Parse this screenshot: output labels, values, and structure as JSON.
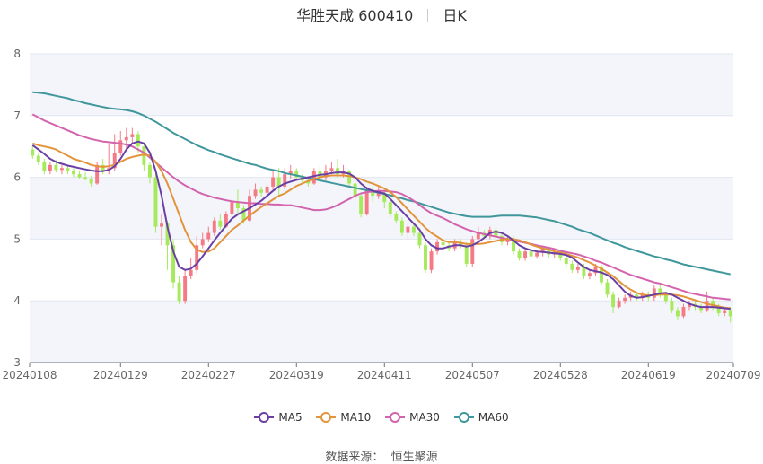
{
  "title": {
    "name": "华胜天成 600410",
    "period": "日K"
  },
  "source": {
    "label": "数据来源：",
    "value": "恒生聚源"
  },
  "colors": {
    "up": "#f47a86",
    "down": "#a6ea5b",
    "ma5": "#6a3fa4",
    "ma10": "#e3943b",
    "ma30": "#d463ad",
    "ma60": "#3f979b",
    "band": "#f3f5fb",
    "grid": "#e0e6f1"
  },
  "chart_data": {
    "type": "candlestick",
    "title": "华胜天成 600410",
    "period": "日K",
    "ylim": [
      3,
      8
    ],
    "yticks": [
      3,
      4,
      5,
      6,
      7,
      8
    ],
    "xtick_labels": [
      "20240108",
      "20240129",
      "20240227",
      "20240319",
      "20240411",
      "20240507",
      "20240528",
      "20240619",
      "20240709"
    ],
    "legend": [
      "MA5",
      "MA10",
      "MA30",
      "MA60"
    ],
    "dates": [
      "20240108",
      "20240109",
      "20240110",
      "20240111",
      "20240112",
      "20240115",
      "20240116",
      "20240117",
      "20240118",
      "20240119",
      "20240122",
      "20240123",
      "20240124",
      "20240125",
      "20240126",
      "20240129",
      "20240130",
      "20240131",
      "20240201",
      "20240202",
      "20240205",
      "20240206",
      "20240207",
      "20240208",
      "20240219",
      "20240220",
      "20240221",
      "20240222",
      "20240223",
      "20240226",
      "20240227",
      "20240228",
      "20240229",
      "20240301",
      "20240304",
      "20240305",
      "20240306",
      "20240307",
      "20240308",
      "20240311",
      "20240312",
      "20240313",
      "20240314",
      "20240315",
      "20240318",
      "20240319",
      "20240320",
      "20240321",
      "20240322",
      "20240325",
      "20240326",
      "20240327",
      "20240328",
      "20240329",
      "20240401",
      "20240402",
      "20240403",
      "20240408",
      "20240409",
      "20240410",
      "20240411",
      "20240412",
      "20240415",
      "20240416",
      "20240417",
      "20240418",
      "20240419",
      "20240422",
      "20240423",
      "20240424",
      "20240425",
      "20240426",
      "20240429",
      "20240430",
      "20240506",
      "20240507",
      "20240508",
      "20240509",
      "20240510",
      "20240513",
      "20240514",
      "20240515",
      "20240516",
      "20240517",
      "20240520",
      "20240521",
      "20240522",
      "20240523",
      "20240524",
      "20240527",
      "20240528",
      "20240529",
      "20240530",
      "20240531",
      "20240603",
      "20240604",
      "20240605",
      "20240606",
      "20240607",
      "20240611",
      "20240612",
      "20240613",
      "20240614",
      "20240617",
      "20240618",
      "20240619",
      "20240620",
      "20240621",
      "20240624",
      "20240625",
      "20240626",
      "20240627",
      "20240628",
      "20240701",
      "20240702",
      "20240703",
      "20240704",
      "20240705",
      "20240708",
      "20240709"
    ],
    "ohlc": [
      [
        6.45,
        6.35,
        6.3,
        6.5
      ],
      [
        6.35,
        6.25,
        6.2,
        6.4
      ],
      [
        6.25,
        6.1,
        6.05,
        6.3
      ],
      [
        6.1,
        6.2,
        6.05,
        6.25
      ],
      [
        6.2,
        6.12,
        6.08,
        6.28
      ],
      [
        6.12,
        6.15,
        6.05,
        6.2
      ],
      [
        6.15,
        6.1,
        6.05,
        6.2
      ],
      [
        6.1,
        6.05,
        6.0,
        6.15
      ],
      [
        6.05,
        6.0,
        5.98,
        6.1
      ],
      [
        6.0,
        5.98,
        5.95,
        6.08
      ],
      [
        5.98,
        5.9,
        5.85,
        6.02
      ],
      [
        5.9,
        6.2,
        5.88,
        6.25
      ],
      [
        6.2,
        6.1,
        6.05,
        6.3
      ],
      [
        6.1,
        6.15,
        6.05,
        6.55
      ],
      [
        6.15,
        6.4,
        6.1,
        6.7
      ],
      [
        6.4,
        6.6,
        6.35,
        6.75
      ],
      [
        6.6,
        6.65,
        6.45,
        6.8
      ],
      [
        6.65,
        6.7,
        6.55,
        6.8
      ],
      [
        6.7,
        6.5,
        6.4,
        6.75
      ],
      [
        6.5,
        6.2,
        6.1,
        6.55
      ],
      [
        6.2,
        6.0,
        5.9,
        6.25
      ],
      [
        6.0,
        5.2,
        5.1,
        6.05
      ],
      [
        5.2,
        5.25,
        4.9,
        5.4
      ],
      [
        5.25,
        4.9,
        4.5,
        5.3
      ],
      [
        4.9,
        4.3,
        4.2,
        5.0
      ],
      [
        4.3,
        4.0,
        3.95,
        4.4
      ],
      [
        4.0,
        4.4,
        3.95,
        4.5
      ],
      [
        4.4,
        4.5,
        4.35,
        4.7
      ],
      [
        4.5,
        4.9,
        4.45,
        5.05
      ],
      [
        4.9,
        5.0,
        4.85,
        5.1
      ],
      [
        5.0,
        5.1,
        4.95,
        5.2
      ],
      [
        5.1,
        5.3,
        5.05,
        5.35
      ],
      [
        5.3,
        5.2,
        5.15,
        5.4
      ],
      [
        5.2,
        5.4,
        5.18,
        5.45
      ],
      [
        5.4,
        5.6,
        5.35,
        5.65
      ],
      [
        5.6,
        5.5,
        5.4,
        5.8
      ],
      [
        5.5,
        5.3,
        5.25,
        5.55
      ],
      [
        5.3,
        5.7,
        5.28,
        5.8
      ],
      [
        5.7,
        5.8,
        5.65,
        5.9
      ],
      [
        5.8,
        5.75,
        5.68,
        5.85
      ],
      [
        5.75,
        5.85,
        5.7,
        5.9
      ],
      [
        5.85,
        6.0,
        5.8,
        6.1
      ],
      [
        6.0,
        5.85,
        5.7,
        6.15
      ],
      [
        5.85,
        6.05,
        5.8,
        6.15
      ],
      [
        6.05,
        6.1,
        5.98,
        6.2
      ],
      [
        6.1,
        6.0,
        5.95,
        6.15
      ],
      [
        6.0,
        5.95,
        5.9,
        6.05
      ],
      [
        5.95,
        5.9,
        5.85,
        6.0
      ],
      [
        5.9,
        6.1,
        5.88,
        6.15
      ],
      [
        6.1,
        6.0,
        5.95,
        6.2
      ],
      [
        6.0,
        6.1,
        5.95,
        6.2
      ],
      [
        6.1,
        6.15,
        6.05,
        6.25
      ],
      [
        6.15,
        6.05,
        6.0,
        6.3
      ],
      [
        6.05,
        6.1,
        6.0,
        6.2
      ],
      [
        6.1,
        5.9,
        5.85,
        6.12
      ],
      [
        5.9,
        5.7,
        5.6,
        5.95
      ],
      [
        5.7,
        5.4,
        5.35,
        5.75
      ],
      [
        5.4,
        5.8,
        5.38,
        5.85
      ],
      [
        5.8,
        5.7,
        5.6,
        5.85
      ],
      [
        5.7,
        5.75,
        5.65,
        5.85
      ],
      [
        5.75,
        5.6,
        5.5,
        5.8
      ],
      [
        5.6,
        5.4,
        5.35,
        5.65
      ],
      [
        5.4,
        5.3,
        5.25,
        5.45
      ],
      [
        5.3,
        5.1,
        5.05,
        5.35
      ],
      [
        5.1,
        5.2,
        5.0,
        5.25
      ],
      [
        5.2,
        5.1,
        5.05,
        5.25
      ],
      [
        5.1,
        4.9,
        4.85,
        5.15
      ],
      [
        4.9,
        4.5,
        4.45,
        4.95
      ],
      [
        4.5,
        4.8,
        4.45,
        4.85
      ],
      [
        4.8,
        4.95,
        4.75,
        5.0
      ],
      [
        4.95,
        4.9,
        4.8,
        5.0
      ],
      [
        4.9,
        4.85,
        4.8,
        4.95
      ],
      [
        4.85,
        4.95,
        4.8,
        5.0
      ],
      [
        4.95,
        4.9,
        4.85,
        5.0
      ],
      [
        4.9,
        4.6,
        4.55,
        4.95
      ],
      [
        4.6,
        5.0,
        4.55,
        5.05
      ],
      [
        5.0,
        5.1,
        4.95,
        5.2
      ],
      [
        5.1,
        5.05,
        5.0,
        5.15
      ],
      [
        5.05,
        5.15,
        5.0,
        5.2
      ],
      [
        5.15,
        5.05,
        4.95,
        5.2
      ],
      [
        5.05,
        4.95,
        4.9,
        5.1
      ],
      [
        4.95,
        5.0,
        4.9,
        5.05
      ],
      [
        5.0,
        4.8,
        4.75,
        5.05
      ],
      [
        4.8,
        4.7,
        4.65,
        4.85
      ],
      [
        4.7,
        4.8,
        4.65,
        4.85
      ],
      [
        4.8,
        4.72,
        4.68,
        4.85
      ],
      [
        4.72,
        4.78,
        4.68,
        4.82
      ],
      [
        4.78,
        4.85,
        4.72,
        4.9
      ],
      [
        4.85,
        4.75,
        4.7,
        4.88
      ],
      [
        4.75,
        4.78,
        4.7,
        4.82
      ],
      [
        4.78,
        4.7,
        4.65,
        4.82
      ],
      [
        4.7,
        4.6,
        4.55,
        4.75
      ],
      [
        4.6,
        4.5,
        4.45,
        4.65
      ],
      [
        4.5,
        4.55,
        4.45,
        4.6
      ],
      [
        4.55,
        4.4,
        4.35,
        4.6
      ],
      [
        4.4,
        4.45,
        4.35,
        4.5
      ],
      [
        4.45,
        4.55,
        4.4,
        4.6
      ],
      [
        4.55,
        4.3,
        4.25,
        4.58
      ],
      [
        4.3,
        4.1,
        4.05,
        4.35
      ],
      [
        4.1,
        3.9,
        3.8,
        4.15
      ],
      [
        3.9,
        4.0,
        3.88,
        4.05
      ],
      [
        4.0,
        4.05,
        3.95,
        4.1
      ],
      [
        4.05,
        4.1,
        4.0,
        4.15
      ],
      [
        4.1,
        4.05,
        4.0,
        4.15
      ],
      [
        4.05,
        4.1,
        4.0,
        4.15
      ],
      [
        4.1,
        4.05,
        4.0,
        4.15
      ],
      [
        4.05,
        4.2,
        4.0,
        4.25
      ],
      [
        4.2,
        4.1,
        4.05,
        4.25
      ],
      [
        4.1,
        4.0,
        3.95,
        4.15
      ],
      [
        4.0,
        3.85,
        3.8,
        4.05
      ],
      [
        3.85,
        3.75,
        3.7,
        3.9
      ],
      [
        3.75,
        3.9,
        3.72,
        3.95
      ],
      [
        3.9,
        3.95,
        3.85,
        4.0
      ],
      [
        3.95,
        3.9,
        3.85,
        4.0
      ],
      [
        3.9,
        3.85,
        3.8,
        3.95
      ],
      [
        3.85,
        4.0,
        3.82,
        4.15
      ],
      [
        4.0,
        3.9,
        3.85,
        4.05
      ],
      [
        3.9,
        3.8,
        3.75,
        3.95
      ],
      [
        3.8,
        3.85,
        3.75,
        3.9
      ],
      [
        3.85,
        3.75,
        3.65,
        3.9
      ]
    ],
    "ma5": [
      6.52,
      6.45,
      6.38,
      6.3,
      6.25,
      6.22,
      6.19,
      6.17,
      6.15,
      6.13,
      6.11,
      6.1,
      6.1,
      6.12,
      6.18,
      6.3,
      6.45,
      6.55,
      6.58,
      6.55,
      6.4,
      6.1,
      5.7,
      5.2,
      4.8,
      4.55,
      4.5,
      4.52,
      4.6,
      4.72,
      4.85,
      4.98,
      5.1,
      5.22,
      5.33,
      5.4,
      5.45,
      5.5,
      5.56,
      5.62,
      5.7,
      5.78,
      5.85,
      5.9,
      5.93,
      5.96,
      5.98,
      6.0,
      6.02,
      6.04,
      6.05,
      6.07,
      6.08,
      6.08,
      6.06,
      6.0,
      5.9,
      5.82,
      5.78,
      5.76,
      5.74,
      5.65,
      5.55,
      5.45,
      5.35,
      5.25,
      5.15,
      5.0,
      4.9,
      4.85,
      4.85,
      4.88,
      4.9,
      4.9,
      4.88,
      4.9,
      4.95,
      5.02,
      5.1,
      5.12,
      5.1,
      5.05,
      4.98,
      4.9,
      4.85,
      4.82,
      4.8,
      4.79,
      4.78,
      4.77,
      4.76,
      4.74,
      4.7,
      4.62,
      4.55,
      4.5,
      4.48,
      4.46,
      4.42,
      4.35,
      4.25,
      4.15,
      4.08,
      4.05,
      4.06,
      4.08,
      4.1,
      4.12,
      4.13,
      4.1,
      4.05,
      4.0,
      3.95,
      3.92,
      3.9,
      3.9,
      3.9,
      3.89,
      3.88,
      3.87
    ],
    "ma10": [
      6.55,
      6.52,
      6.5,
      6.48,
      6.45,
      6.4,
      6.35,
      6.3,
      6.27,
      6.24,
      6.2,
      6.18,
      6.17,
      6.18,
      6.2,
      6.25,
      6.3,
      6.33,
      6.35,
      6.37,
      6.35,
      6.25,
      6.1,
      5.9,
      5.65,
      5.4,
      5.15,
      4.95,
      4.83,
      4.79,
      4.8,
      4.85,
      4.95,
      5.05,
      5.15,
      5.22,
      5.3,
      5.38,
      5.45,
      5.52,
      5.58,
      5.64,
      5.7,
      5.74,
      5.8,
      5.86,
      5.9,
      5.94,
      5.97,
      6.0,
      6.02,
      6.03,
      6.03,
      6.03,
      6.02,
      6.0,
      5.97,
      5.93,
      5.9,
      5.86,
      5.82,
      5.76,
      5.68,
      5.58,
      5.48,
      5.38,
      5.28,
      5.18,
      5.1,
      5.04,
      4.98,
      4.95,
      4.95,
      4.94,
      4.92,
      4.92,
      4.92,
      4.93,
      4.95,
      4.97,
      4.99,
      5.0,
      5.0,
      4.98,
      4.95,
      4.91,
      4.88,
      4.85,
      4.83,
      4.8,
      4.78,
      4.76,
      4.73,
      4.7,
      4.66,
      4.62,
      4.57,
      4.52,
      4.46,
      4.4,
      4.32,
      4.24,
      4.18,
      4.13,
      4.1,
      4.09,
      4.09,
      4.1,
      4.1,
      4.1,
      4.09,
      4.07,
      4.04,
      4.01,
      3.98,
      3.95,
      3.93,
      3.91,
      3.89,
      3.88
    ],
    "ma30": [
      7.02,
      6.97,
      6.92,
      6.88,
      6.84,
      6.8,
      6.76,
      6.72,
      6.68,
      6.65,
      6.62,
      6.6,
      6.58,
      6.57,
      6.56,
      6.55,
      6.53,
      6.5,
      6.45,
      6.4,
      6.32,
      6.24,
      6.16,
      6.08,
      6.0,
      5.93,
      5.87,
      5.82,
      5.77,
      5.73,
      5.7,
      5.67,
      5.65,
      5.63,
      5.61,
      5.6,
      5.59,
      5.58,
      5.58,
      5.57,
      5.57,
      5.56,
      5.56,
      5.55,
      5.55,
      5.53,
      5.51,
      5.49,
      5.47,
      5.47,
      5.48,
      5.51,
      5.55,
      5.6,
      5.65,
      5.7,
      5.74,
      5.76,
      5.77,
      5.78,
      5.78,
      5.77,
      5.76,
      5.73,
      5.68,
      5.62,
      5.55,
      5.48,
      5.42,
      5.38,
      5.34,
      5.29,
      5.24,
      5.2,
      5.16,
      5.13,
      5.1,
      5.08,
      5.06,
      5.04,
      5.02,
      5.0,
      4.98,
      4.96,
      4.94,
      4.92,
      4.9,
      4.88,
      4.86,
      4.84,
      4.81,
      4.79,
      4.77,
      4.75,
      4.72,
      4.69,
      4.65,
      4.62,
      4.58,
      4.54,
      4.5,
      4.46,
      4.42,
      4.39,
      4.36,
      4.33,
      4.3,
      4.28,
      4.25,
      4.22,
      4.19,
      4.16,
      4.13,
      4.11,
      4.09,
      4.07,
      4.05,
      4.04,
      4.03,
      4.02
    ],
    "ma60": [
      7.38,
      7.37,
      7.36,
      7.34,
      7.32,
      7.3,
      7.28,
      7.25,
      7.23,
      7.2,
      7.18,
      7.16,
      7.14,
      7.12,
      7.11,
      7.1,
      7.09,
      7.07,
      7.04,
      7.0,
      6.95,
      6.9,
      6.84,
      6.78,
      6.72,
      6.67,
      6.62,
      6.57,
      6.52,
      6.48,
      6.44,
      6.41,
      6.37,
      6.34,
      6.31,
      6.28,
      6.25,
      6.22,
      6.2,
      6.17,
      6.14,
      6.12,
      6.1,
      6.07,
      6.05,
      6.03,
      6.01,
      5.99,
      5.97,
      5.95,
      5.93,
      5.91,
      5.89,
      5.87,
      5.85,
      5.83,
      5.81,
      5.79,
      5.77,
      5.75,
      5.73,
      5.71,
      5.68,
      5.66,
      5.63,
      5.61,
      5.58,
      5.55,
      5.52,
      5.49,
      5.46,
      5.43,
      5.41,
      5.39,
      5.37,
      5.36,
      5.36,
      5.36,
      5.36,
      5.37,
      5.38,
      5.38,
      5.38,
      5.38,
      5.37,
      5.36,
      5.35,
      5.33,
      5.31,
      5.29,
      5.26,
      5.23,
      5.2,
      5.16,
      5.13,
      5.1,
      5.06,
      5.02,
      4.98,
      4.94,
      4.91,
      4.87,
      4.84,
      4.81,
      4.78,
      4.75,
      4.72,
      4.7,
      4.67,
      4.65,
      4.62,
      4.59,
      4.57,
      4.55,
      4.53,
      4.51,
      4.49,
      4.47,
      4.45,
      4.43
    ]
  }
}
